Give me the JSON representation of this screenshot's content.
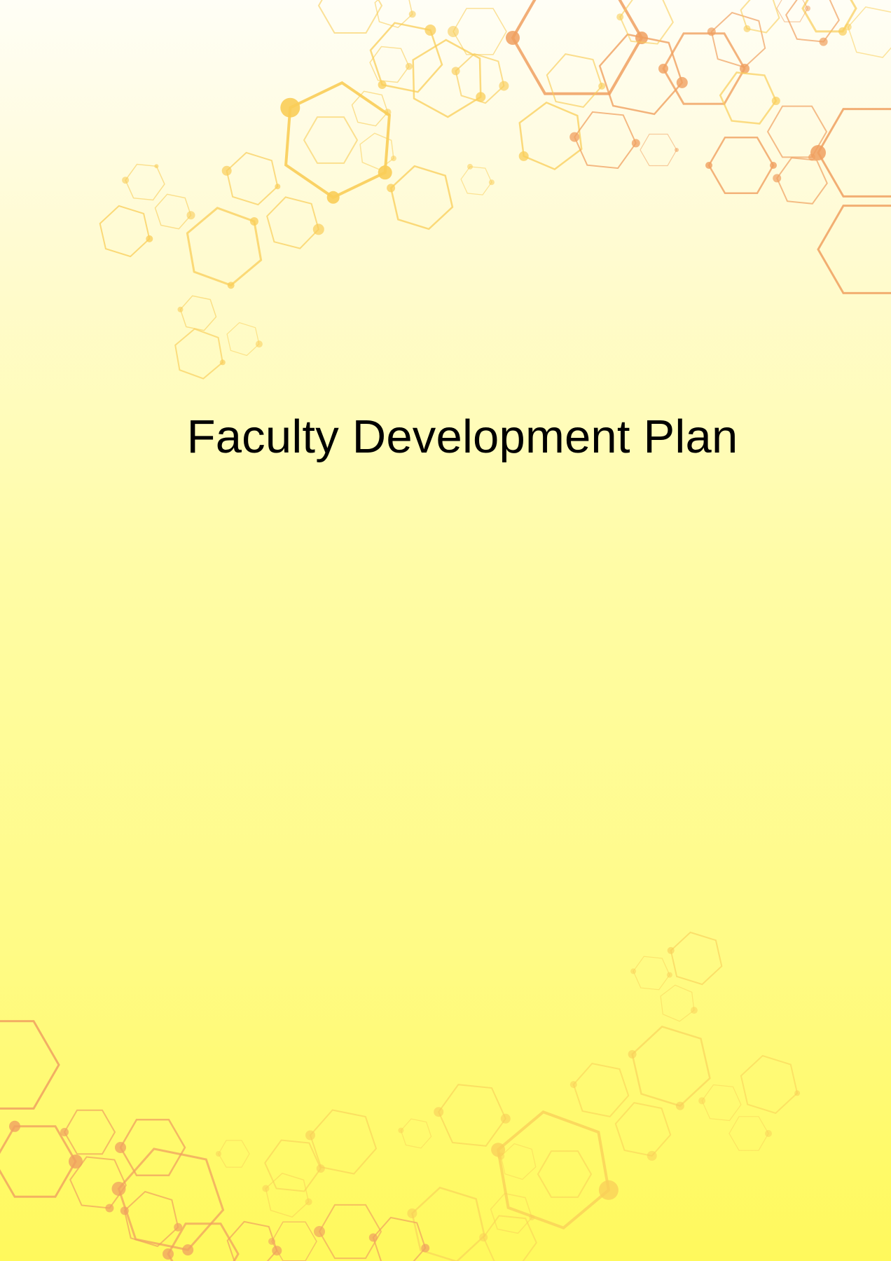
{
  "document": {
    "title": "Faculty Development Plan"
  },
  "colors": {
    "background_top": "#fffef6",
    "background_bottom": "#fff95c",
    "hex_light": "#f9cd58",
    "hex_dark": "#f0a060",
    "title_text": "#000000"
  },
  "decoration": {
    "top_right": "hexagon-network",
    "bottom_left": "hexagon-network"
  }
}
